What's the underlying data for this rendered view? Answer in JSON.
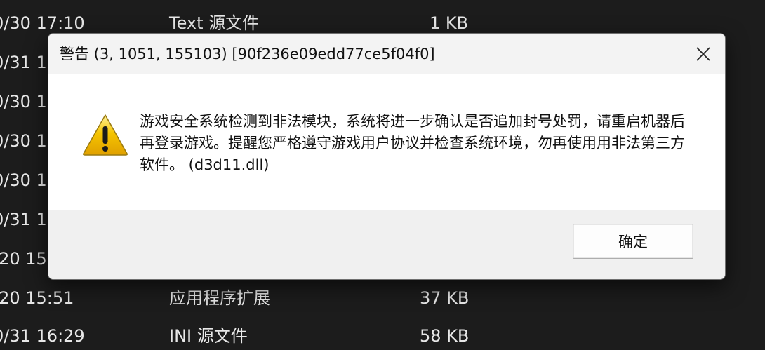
{
  "background_list": {
    "rows": [
      {
        "date": "0/30 17:10",
        "type": "Text 源文件",
        "size": "1 KB"
      },
      {
        "date": "0/31 1",
        "type": "",
        "size": ""
      },
      {
        "date": "0/30 1",
        "type": "",
        "size": ""
      },
      {
        "date": "0/30 1",
        "type": "",
        "size": ""
      },
      {
        "date": "0/30 1",
        "type": "",
        "size": ""
      },
      {
        "date": "0/31 1",
        "type": "",
        "size": ""
      },
      {
        "date": "/20 15",
        "type": "",
        "size": ""
      },
      {
        "date": "/20 15:51",
        "type": "应用程序扩展",
        "size": "37 KB"
      },
      {
        "date": "0/31 16:29",
        "type": "INI 源文件",
        "size": "58 KB"
      }
    ]
  },
  "dialog": {
    "title": "警告 (3, 1051, 155103) [90f236e09edd77ce5f04f0]",
    "icon": "warning-triangle-icon",
    "message": "游戏安全系统检测到非法模块，系统将进一步确认是否追加封号处罚，请重启机器后再登录游戏。提醒您严格遵守游戏用户协议并检查系统环境，勿再使用用非法第三方软件。 (d3d11.dll)",
    "ok_label": "确定",
    "close_icon": "close-icon"
  },
  "colors": {
    "background": "#1c1c1c",
    "dialog_body": "#ffffff",
    "dialog_titlebar": "#f3f3f3",
    "dialog_footer": "#f0f0f0",
    "warning_yellow": "#f5c400"
  }
}
